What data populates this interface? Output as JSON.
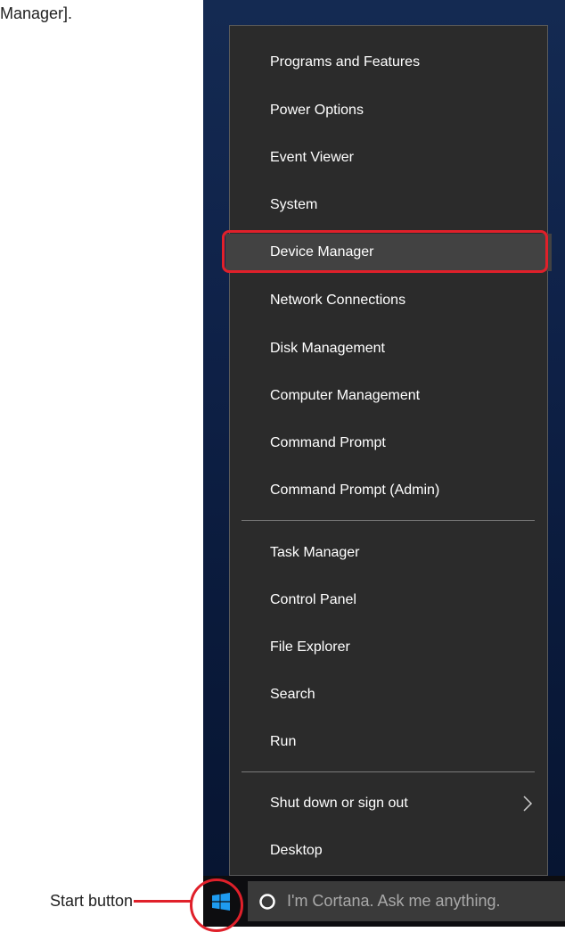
{
  "caption": {
    "text": "Manager]."
  },
  "menu": {
    "items": [
      {
        "label": "Programs and Features"
      },
      {
        "label": "Power Options"
      },
      {
        "label": "Event Viewer"
      },
      {
        "label": "System"
      },
      {
        "label": "Device Manager",
        "selected": true
      },
      {
        "label": "Network Connections"
      },
      {
        "label": "Disk Management"
      },
      {
        "label": "Computer Management"
      },
      {
        "label": "Command Prompt"
      },
      {
        "label": "Command Prompt (Admin)"
      },
      {
        "label": "Task Manager"
      },
      {
        "label": "Control Panel"
      },
      {
        "label": "File Explorer"
      },
      {
        "label": "Search"
      },
      {
        "label": "Run"
      },
      {
        "label": "Shut down or sign out",
        "has_submenu": true,
        "submenu_icon": "chevron-right-icon"
      },
      {
        "label": "Desktop"
      }
    ]
  },
  "taskbar": {
    "start_icon": "windows-logo-icon",
    "cortana_icon": "cortana-circle-icon",
    "cortana_placeholder": "I'm Cortana. Ask me anything."
  },
  "annotation": {
    "start_label": "Start button"
  },
  "colors": {
    "menu_bg": "#2b2b2b",
    "menu_selected_bg": "#424242",
    "menu_text": "#ffffff",
    "highlight": "#e0202a",
    "taskbar_bg": "#0d0d10",
    "windows_blue": "#1e9bf0"
  }
}
